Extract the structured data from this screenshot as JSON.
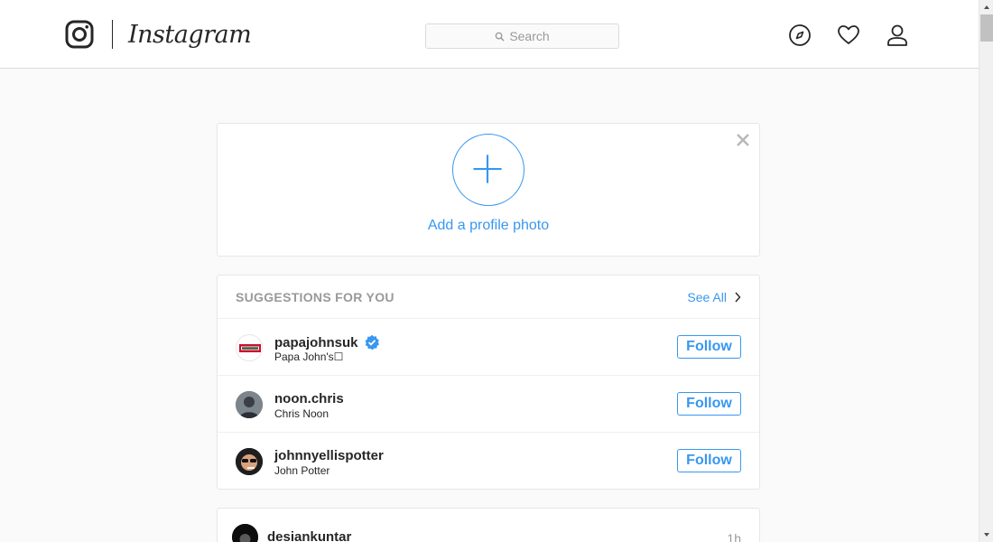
{
  "header": {
    "wordmark": "Instagram",
    "search_placeholder": "Search",
    "icons": [
      "instagram-logo-icon",
      "search-icon",
      "compass-icon",
      "heart-icon",
      "user-icon"
    ]
  },
  "profile_prompt": {
    "label": "Add a profile photo",
    "icons": [
      "plus-icon",
      "close-icon"
    ]
  },
  "suggestions": {
    "title": "SUGGESTIONS FOR YOU",
    "see_all": "See All",
    "items": [
      {
        "username": "papajohnsuk",
        "full_name": "Papa John's☐",
        "verified": true,
        "follow_label": "Follow"
      },
      {
        "username": "noon.chris",
        "full_name": "Chris Noon",
        "verified": false,
        "follow_label": "Follow"
      },
      {
        "username": "johnnyellispotter",
        "full_name": "John Potter",
        "verified": false,
        "follow_label": "Follow"
      }
    ]
  },
  "feed": {
    "post": {
      "username": "desiankuntar",
      "time": "1h"
    }
  },
  "colors": {
    "accent": "#3897f0",
    "text": "#262626",
    "muted": "#999999",
    "border": "#dbdbdb",
    "background": "#fafafa"
  }
}
